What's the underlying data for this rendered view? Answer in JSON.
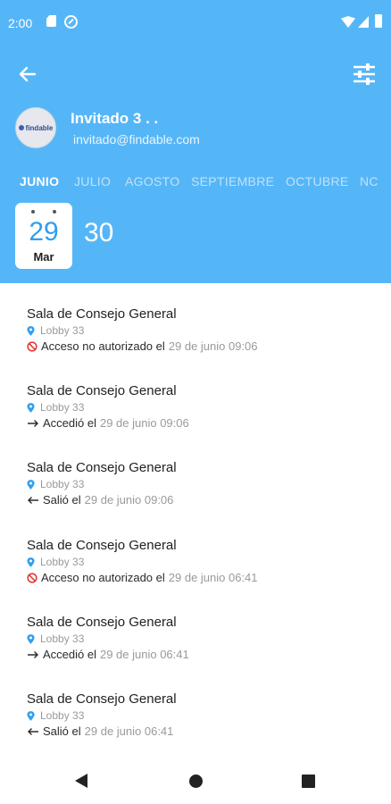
{
  "status_bar": {
    "time": "2:00"
  },
  "user": {
    "name": "Invitado 3 . .",
    "email": "invitado@findable.com",
    "avatar_text": "findable"
  },
  "months": [
    "JUNIO",
    "JULIO",
    "AGOSTO",
    "SEPTIEMBRE",
    "OCTUBRE",
    "NC"
  ],
  "active_month": "JUNIO",
  "date_card": {
    "day": "29",
    "month": "Mar"
  },
  "count": "30",
  "entries": [
    {
      "title": "Sala de Consejo General",
      "location": "Lobby 33",
      "event_type": "denied",
      "event_text": "Acceso no autorizado el",
      "time": "29 de junio 09:06"
    },
    {
      "title": "Sala de Consejo General",
      "location": "Lobby 33",
      "event_type": "entered",
      "event_text": "Accedió el",
      "time": "29 de junio 09:06"
    },
    {
      "title": "Sala de Consejo General",
      "location": "Lobby 33",
      "event_type": "exited",
      "event_text": "Salió el",
      "time": "29 de junio 09:06"
    },
    {
      "title": "Sala de Consejo General",
      "location": "Lobby 33",
      "event_type": "denied",
      "event_text": "Acceso no autorizado el",
      "time": "29 de junio 06:41"
    },
    {
      "title": "Sala de Consejo General",
      "location": "Lobby 33",
      "event_type": "entered",
      "event_text": "Accedió el",
      "time": "29 de junio 06:41"
    },
    {
      "title": "Sala de Consejo General",
      "location": "Lobby 33",
      "event_type": "exited",
      "event_text": "Salió el",
      "time": "29 de junio 06:41"
    }
  ],
  "colors": {
    "header": "#55b6f7",
    "accent": "#2f9ff0",
    "denied": "#e53935",
    "location": "#2f9ff0"
  },
  "icons": {
    "back": "arrow-left-icon",
    "filter": "sliders-icon",
    "location": "location-pin-icon",
    "denied": "no-entry-icon",
    "entered": "arrow-right-icon",
    "exited": "arrow-left-icon"
  }
}
